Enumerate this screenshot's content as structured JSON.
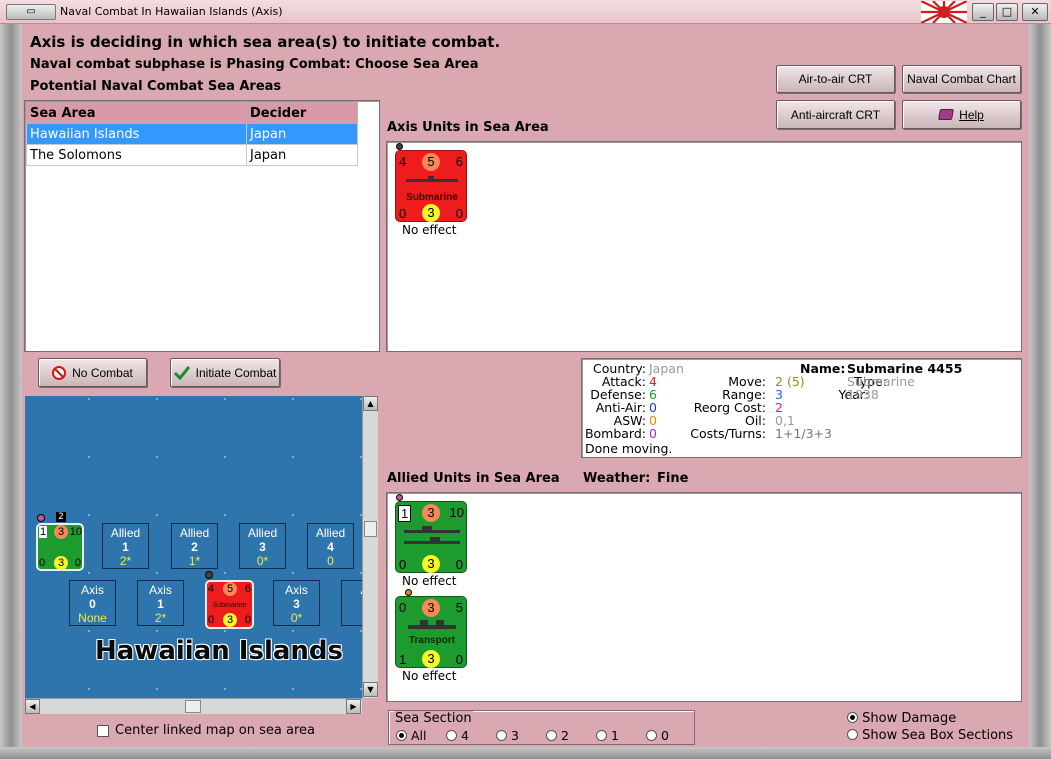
{
  "window": {
    "title": "Naval Combat In Hawaiian Islands (Axis)"
  },
  "header": {
    "line1": "Axis is deciding in which sea area(s) to initiate combat.",
    "line2": "Naval combat subphase is Phasing Combat: Choose Sea Area",
    "line3": "Potential Naval Combat Sea Areas"
  },
  "buttons": {
    "air_to_air": "Air-to-air CRT",
    "naval_chart": "Naval Combat Chart",
    "anti_aircraft": "Anti-aircraft CRT",
    "help": "Help",
    "no_combat": "No Combat",
    "initiate": "Initiate Combat"
  },
  "sea_table": {
    "headers": [
      "Sea Area",
      "Decider"
    ],
    "rows": [
      {
        "area": "Hawaiian Islands",
        "decider": "Japan"
      },
      {
        "area": "The Solomons",
        "decider": "Japan"
      }
    ]
  },
  "axis_units": {
    "title": "Axis Units in Sea Area",
    "unit": {
      "top_left": "4",
      "top_mid": "5",
      "top_right": "6",
      "name": "Submarine",
      "bot_left": "0",
      "bot_mid": "3",
      "bot_right": "0",
      "status": "No effect"
    }
  },
  "info": {
    "country_k": "Country:",
    "country_v": "Japan",
    "attack_k": "Attack:",
    "attack_v": "4",
    "defense_k": "Defense:",
    "defense_v": "6",
    "antiair_k": "Anti-Air:",
    "antiair_v": "0",
    "asw_k": "ASW:",
    "asw_v": "0",
    "bombard_k": "Bombard:",
    "bombard_v": "0",
    "move_k": "Move:",
    "move_v": "2",
    "move_extra": "(5)",
    "range_k": "Range:",
    "range_v": "3",
    "reorg_k": "Reorg Cost:",
    "reorg_v": "2",
    "oil_k": "Oil:",
    "oil_v": "0,1",
    "costs_k": "Costs/Turns:",
    "costs_v": "1+1/3+3",
    "name_k": "Name:",
    "name_v": "Submarine 4455",
    "type_k": "Type:",
    "type_v": "Submarine",
    "year_k": "Year:",
    "year_v": "1938",
    "status": "Done moving."
  },
  "allied": {
    "title": "Allied Units in Sea Area",
    "weather_label": "Weather:",
    "weather_value": "Fine",
    "units": [
      {
        "top_left": "1",
        "top_mid": "3",
        "top_right": "10",
        "name": "",
        "bot_left": "0",
        "bot_mid": "3",
        "bot_right": "0",
        "status": "No effect"
      },
      {
        "top_left": "0",
        "top_mid": "3",
        "top_right": "5",
        "name": "Transport",
        "bot_left": "1",
        "bot_mid": "3",
        "bot_right": "0",
        "status": "No effect"
      }
    ]
  },
  "map": {
    "title": "Hawaiian Islands",
    "allied_boxes": [
      {
        "label": "Allied",
        "num": "1",
        "val": "2*"
      },
      {
        "label": "Allied",
        "num": "2",
        "val": "1*"
      },
      {
        "label": "Allied",
        "num": "3",
        "val": "0*"
      },
      {
        "label": "Allied",
        "num": "4",
        "val": "0"
      }
    ],
    "axis_boxes": [
      {
        "label": "Axis",
        "num": "0",
        "val": "None"
      },
      {
        "label": "Axis",
        "num": "1",
        "val": "2*"
      },
      {
        "label": "Axis",
        "num": "3",
        "val": "0*"
      },
      {
        "label": "A",
        "num": "",
        "val": ""
      }
    ],
    "mini_allied": {
      "tl": "1",
      "tm": "3",
      "tr": "10",
      "bl": "0",
      "bm": "3",
      "br": "0",
      "badge": "2"
    },
    "mini_axis": {
      "tl": "4",
      "tm": "5",
      "tr": "6",
      "name": "Submarine",
      "bl": "0",
      "bm": "3",
      "br": "0"
    }
  },
  "bottom": {
    "center_map": "Center linked map on sea area",
    "sea_section": "Sea Section",
    "sections": [
      "All",
      "4",
      "3",
      "2",
      "1",
      "0"
    ],
    "show_damage": "Show Damage",
    "show_boxes": "Show Sea Box Sections"
  },
  "colors": {
    "background": "#d9a8b0",
    "selected_row": "#3399ff",
    "axis_unit": "#ee1c1c",
    "allied_unit": "#1e9b2e",
    "map_sea": "#2f75ad"
  }
}
